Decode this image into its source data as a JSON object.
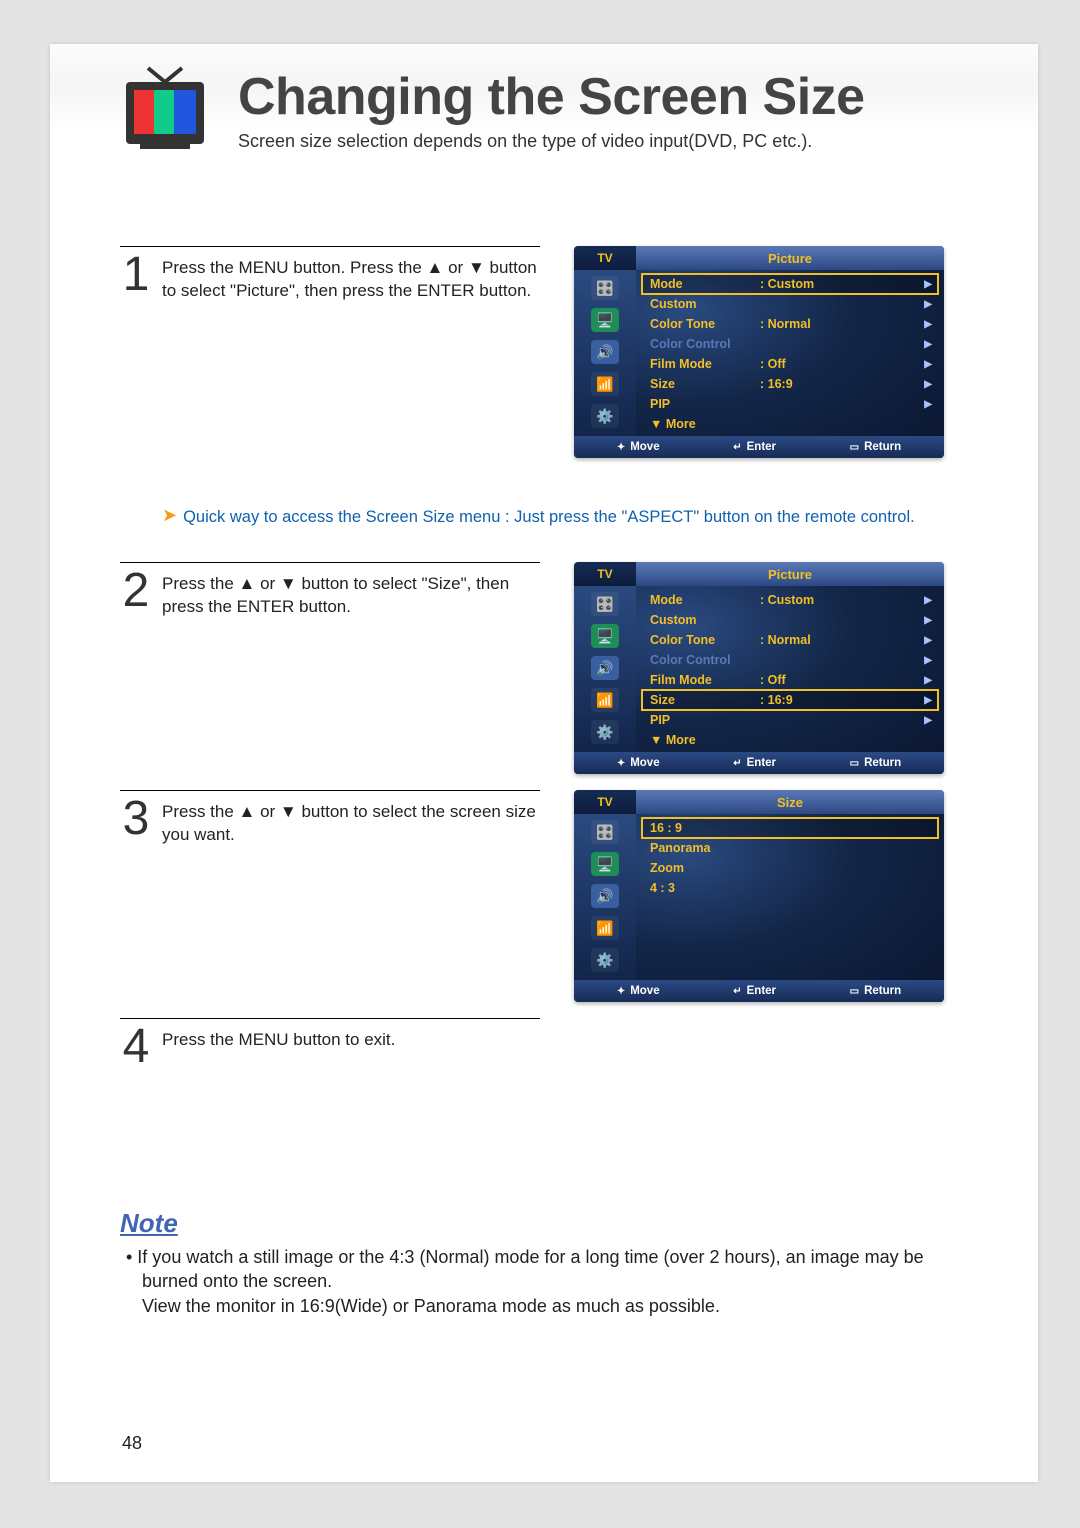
{
  "header": {
    "title": "Changing the Screen Size",
    "subtitle": "Screen size selection depends on the type of video input(DVD, PC etc.)."
  },
  "steps": [
    {
      "num": "1",
      "text": "Press the MENU button. Press the ▲ or ▼ button to select \"Picture\", then press the ENTER button.",
      "quick": "Quick way to access the Screen Size menu : Just press the \"ASPECT\" button on the remote control."
    },
    {
      "num": "2",
      "text": "Press the ▲ or ▼ button to select \"Size\", then press the ENTER button."
    },
    {
      "num": "3",
      "text": "Press the ▲ or ▼ button to select the screen size you want."
    },
    {
      "num": "4",
      "text": "Press the MENU button to exit."
    }
  ],
  "osd_common": {
    "tv": "TV",
    "footer": {
      "move": "Move",
      "enter": "Enter",
      "return": "Return"
    }
  },
  "osd1": {
    "title": "Picture",
    "items": [
      {
        "label": "Mode",
        "value": ":  Custom",
        "caret": true,
        "highlight": true
      },
      {
        "label": "Custom",
        "value": "",
        "caret": true
      },
      {
        "label": "Color Tone",
        "value": ":  Normal",
        "caret": true
      },
      {
        "label": "Color Control",
        "value": "",
        "caret": true,
        "dim": true
      },
      {
        "label": "Film Mode",
        "value": ":  Off",
        "caret": true
      },
      {
        "label": "Size",
        "value": ":  16:9",
        "caret": true
      },
      {
        "label": "PIP",
        "value": "",
        "caret": true
      },
      {
        "label": "▼ More",
        "value": "",
        "more": true
      }
    ]
  },
  "osd2": {
    "title": "Picture",
    "items": [
      {
        "label": "Mode",
        "value": ":  Custom",
        "caret": true
      },
      {
        "label": "Custom",
        "value": "",
        "caret": true
      },
      {
        "label": "Color Tone",
        "value": ":  Normal",
        "caret": true
      },
      {
        "label": "Color Control",
        "value": "",
        "caret": true,
        "dim": true
      },
      {
        "label": "Film Mode",
        "value": ":  Off",
        "caret": true
      },
      {
        "label": "Size",
        "value": ":  16:9",
        "caret": true,
        "highlight": true
      },
      {
        "label": "PIP",
        "value": "",
        "caret": true
      },
      {
        "label": "▼ More",
        "value": "",
        "more": true
      }
    ]
  },
  "osd3": {
    "title": "Size",
    "items": [
      {
        "label": "16 : 9",
        "value": "",
        "highlight": true
      },
      {
        "label": "Panorama",
        "value": ""
      },
      {
        "label": "Zoom",
        "value": ""
      },
      {
        "label": "4 : 3",
        "value": ""
      },
      {
        "label": " ",
        "value": ""
      },
      {
        "label": " ",
        "value": ""
      },
      {
        "label": " ",
        "value": ""
      },
      {
        "label": " ",
        "value": ""
      }
    ]
  },
  "note": {
    "heading": "Note",
    "body": "•  If you watch a still image or the 4:3 (Normal) mode for a long time (over 2 hours), an image may be burned onto the screen.\nView the monitor in 16:9(Wide) or Panorama mode as much as possible."
  },
  "page_number": "48"
}
